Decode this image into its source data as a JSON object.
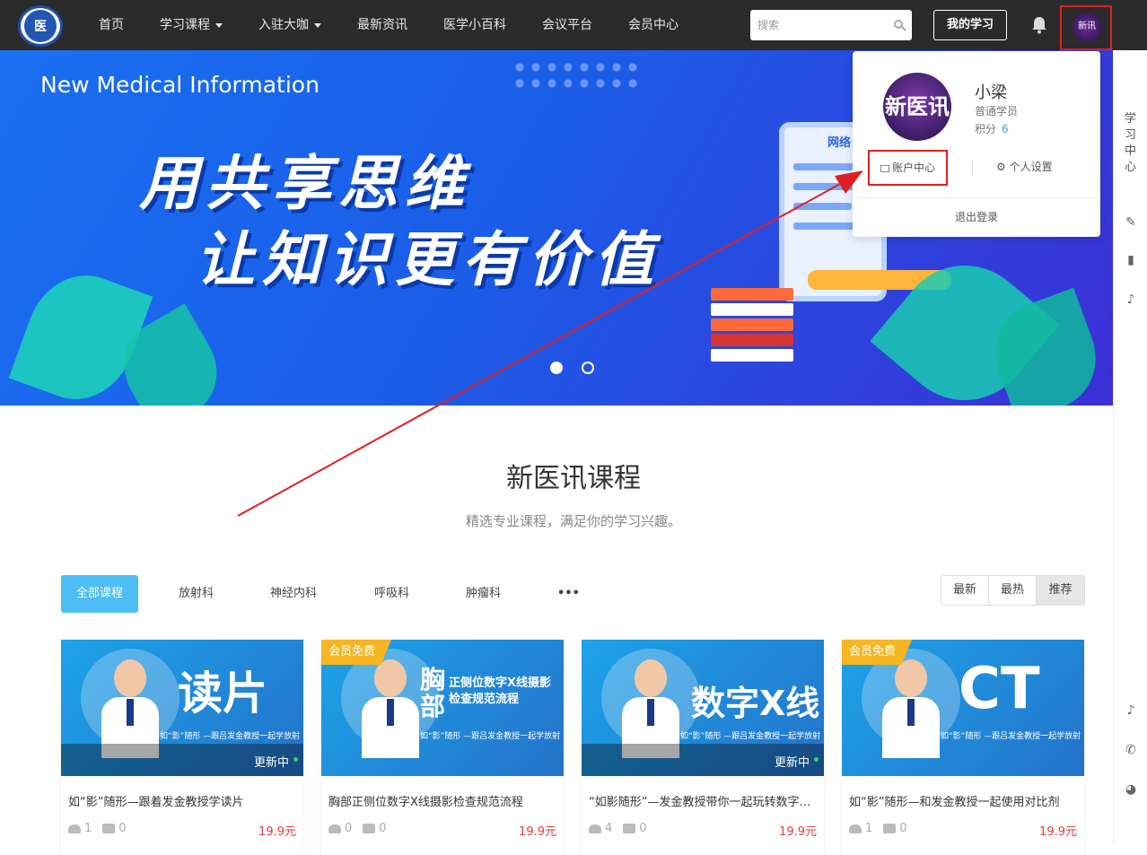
{
  "nav": {
    "logo_text": "医",
    "items": [
      {
        "label": "首页",
        "dropdown": false
      },
      {
        "label": "学习课程",
        "dropdown": true
      },
      {
        "label": "入驻大咖",
        "dropdown": true
      },
      {
        "label": "最新资讯",
        "dropdown": false
      },
      {
        "label": "医学小百科",
        "dropdown": false
      },
      {
        "label": "会议平台",
        "dropdown": false
      },
      {
        "label": "会员中心",
        "dropdown": false
      }
    ],
    "search_placeholder": "搜索",
    "my_study": "我的学习",
    "avatar_text": "新讯"
  },
  "banner": {
    "subtitle": "New Medical Information",
    "line1": "用共享思维",
    "line2": "让知识更有价值",
    "device_label": "网络",
    "active_slide": 1,
    "slide_count": 2
  },
  "user_popup": {
    "avatar_text": "新医讯",
    "name": "小梁",
    "role": "普通学员",
    "points_label": "积分",
    "points_value": "6",
    "account_center": "账户中心",
    "personal_settings": "个人设置",
    "logout": "退出登录"
  },
  "sidebar": {
    "learning_center": "学习中心",
    "icons": [
      "edit-icon",
      "book-icon",
      "bell-icon",
      "notification-icon",
      "phone-icon",
      "wechat-icon"
    ]
  },
  "section": {
    "title": "新医讯课程",
    "subtitle": "精选专业课程，满足你的学习兴趣。"
  },
  "filters": [
    "全部课程",
    "放射科",
    "神经内科",
    "呼吸科",
    "肿瘤科",
    "•••"
  ],
  "sort": [
    "最新",
    "最热",
    "推荐"
  ],
  "courses": [
    {
      "title": "如“影”随形—跟着发金教授学读片",
      "students": "1",
      "comments": "0",
      "price": "19.9元",
      "status": "更新中",
      "free_tag": "",
      "thumb_big": "读片",
      "thumb_small": "",
      "thumb_caption": "如“影”随形 —跟吕发金教授一起学放射"
    },
    {
      "title": "胸部正侧位数字X线摄影检查规范流程",
      "students": "0",
      "comments": "0",
      "price": "19.9元",
      "status": "",
      "free_tag": "会员免费",
      "thumb_big": "胸部",
      "thumb_small": "正侧位数字X线摄影 检查规范流程",
      "thumb_caption": "如“影”随形 —跟吕发金教授一起学放射"
    },
    {
      "title": "“如影随形”—发金教授带你一起玩转数字X线",
      "students": "4",
      "comments": "0",
      "price": "19.9元",
      "status": "更新中",
      "free_tag": "",
      "thumb_big": "数字X线",
      "thumb_small": "",
      "thumb_caption": "如“影”随形 —跟吕发金教授一起学放射"
    },
    {
      "title": "如“影”随形—和发金教授一起使用对比剂",
      "students": "1",
      "comments": "0",
      "price": "19.9元",
      "status": "",
      "free_tag": "会员免费",
      "thumb_big": "CT",
      "thumb_small": "",
      "thumb_caption": "如“影”随形 —跟吕发金教授一起学放射"
    }
  ],
  "colors": {
    "nav_bg": "#2b2b2b",
    "accent": "#4dbdf5",
    "highlight_border": "#e02020",
    "price": "#e23c3c",
    "free_tag": "#f5b622"
  }
}
